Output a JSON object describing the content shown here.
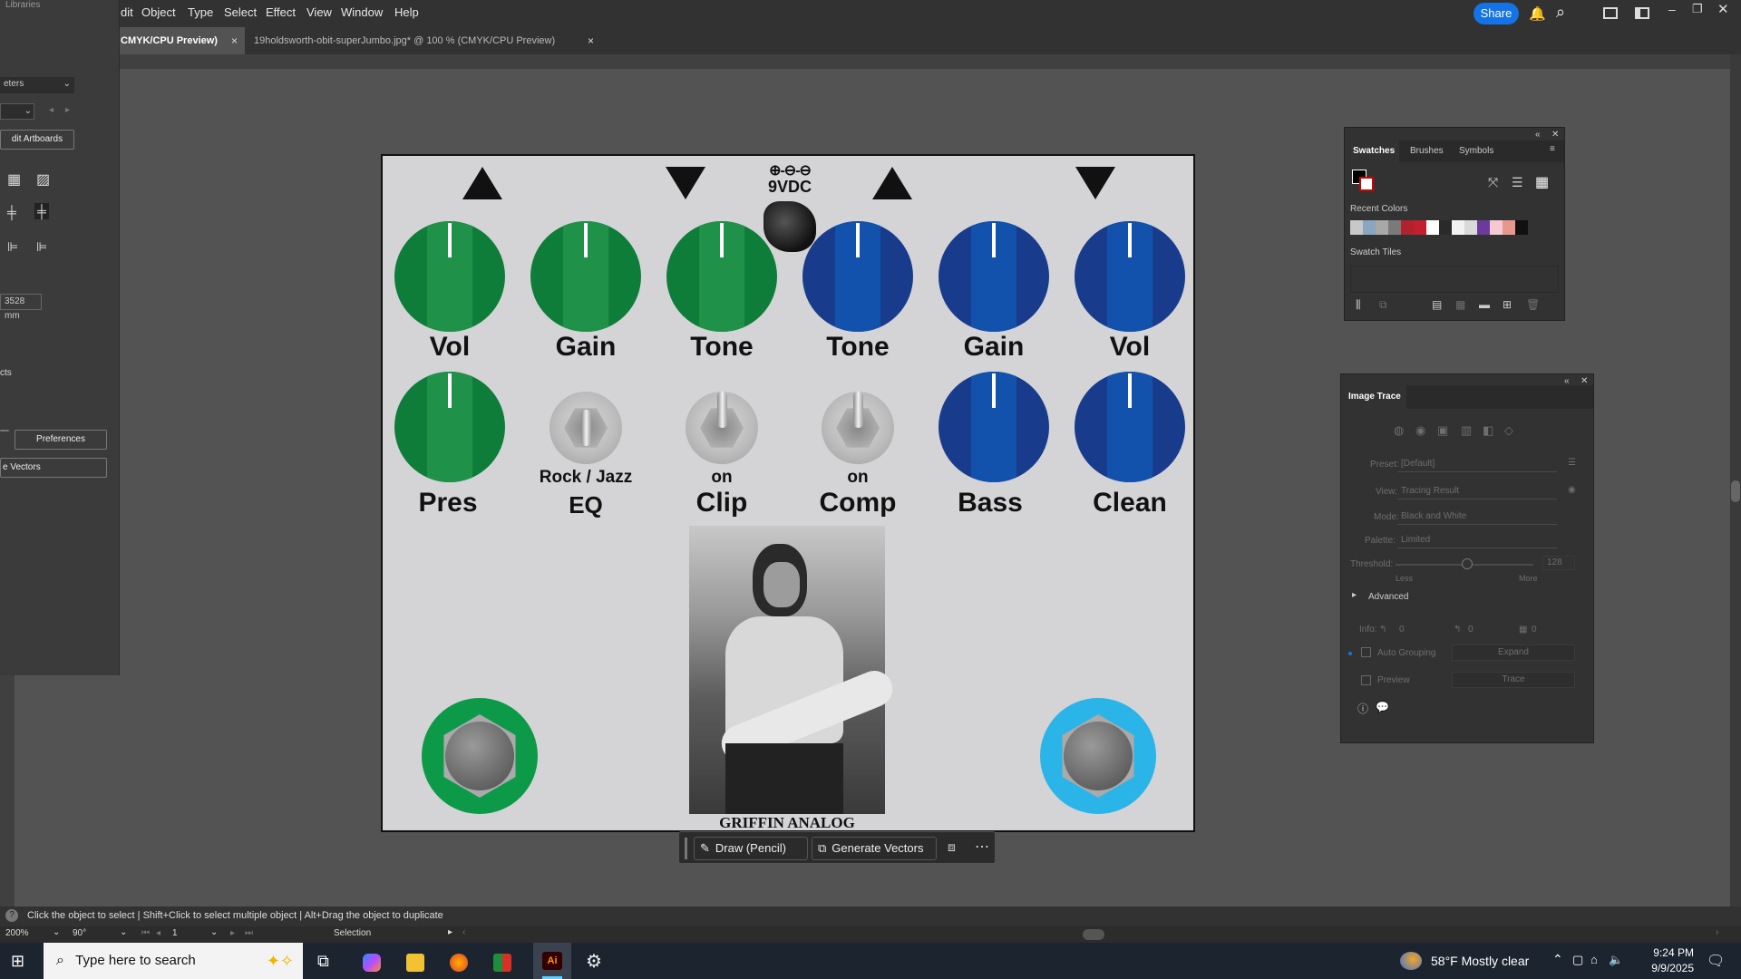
{
  "menubar": {
    "items": [
      "dit",
      "Object",
      "Type",
      "Select",
      "Effect",
      "View",
      "Window",
      "Help"
    ],
    "share_label": "Share"
  },
  "tabs": [
    {
      "label": "CMYK/CPU Preview)",
      "close": "×"
    },
    {
      "label": "19holdsworth-obit-superJumbo.jpg* @ 100 % (CMYK/CPU Preview)",
      "close": "×"
    }
  ],
  "left_panel": {
    "libraries_label": "Libraries",
    "meters_label": "eters",
    "edit_artboards": "dit Artboards",
    "measure_value": "3528 mm",
    "effects_label": "cts",
    "preferences_label": "Preferences",
    "vectors_label": "e Vectors"
  },
  "pedal": {
    "dc_label": "9VDC",
    "brand": "GRIFFIN ANALOG",
    "knob_labels_row1": [
      "Vol",
      "Gain",
      "Tone",
      "Tone",
      "Gain",
      "Vol"
    ],
    "knob_labels_row2": [
      "Pres",
      "Bass",
      "Clean"
    ],
    "toggle_captions": [
      "Rock / Jazz",
      "on",
      "on"
    ],
    "toggle_labels": [
      "EQ",
      "Clip",
      "Comp"
    ]
  },
  "swatches_panel": {
    "tabs": [
      "Swatches",
      "Brushes",
      "Symbols"
    ],
    "recent_colors_label": "Recent Colors",
    "swatch_tiles_label": "Swatch Tiles",
    "recent_colors": [
      "#c8c8c8",
      "#8aa6c0",
      "#a8a8a8",
      "#7a7a7a",
      "#b0232e",
      "#c21f2f",
      "#ffffff",
      "#2a2a2a",
      "#f2f2f2",
      "#d9d9d9",
      "#6a3b9c",
      "#f4c9cf",
      "#e8978f",
      "#111111"
    ]
  },
  "image_trace": {
    "title": "Image Trace",
    "preset_label": "Preset:",
    "preset_value": "[Default]",
    "view_label": "View:",
    "view_value": "Tracing Result",
    "mode_label": "Mode:",
    "mode_value": "Black and White",
    "palette_label": "Palette:",
    "palette_value": "Limited",
    "threshold_label": "Threshold:",
    "threshold_value": "128",
    "less_label": "Less",
    "more_label": "More",
    "advanced_label": "Advanced",
    "info_label": "Info:",
    "info_values": [
      "0",
      "0",
      "0"
    ],
    "auto_grouping_label": "Auto Grouping",
    "expand_label": "Expand",
    "preview_label": "Preview",
    "trace_label": "Trace"
  },
  "context_bar": {
    "draw_label": "Draw (Pencil)",
    "generate_label": "Generate Vectors"
  },
  "status": {
    "hint": "Click the object to select  |  Shift+Click to select multiple object  |  Alt+Drag the object to duplicate",
    "zoom": "200%",
    "rotate": "90°",
    "artboard_num": "1",
    "mode": "Selection"
  },
  "taskbar": {
    "search_placeholder": "Type here to search",
    "weather": "58°F  Mostly clear",
    "time": "9:24 PM",
    "date": "9/9/2025"
  }
}
